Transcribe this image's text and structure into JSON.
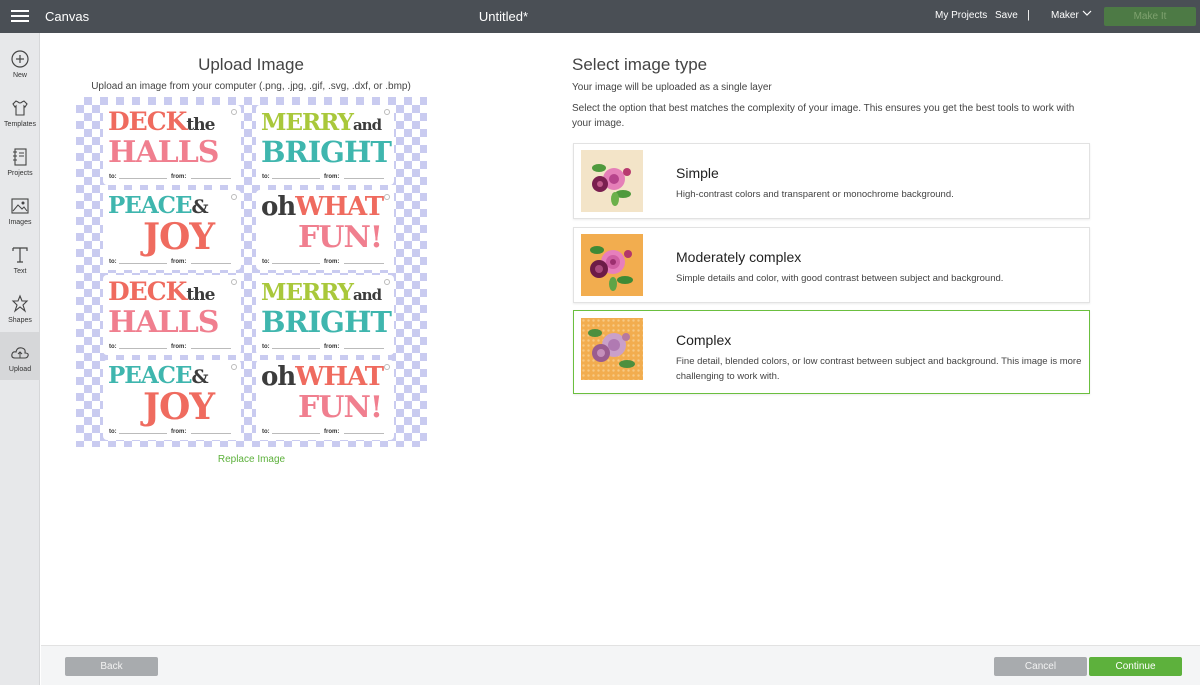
{
  "topbar": {
    "app_title": "Canvas",
    "doc_title": "Untitled*",
    "my_projects": "My Projects",
    "save": "Save",
    "separator": "|",
    "machine": "Maker",
    "make_it": "Make It"
  },
  "sidebar": {
    "items": [
      {
        "label": "New",
        "icon": "plus-circle-icon"
      },
      {
        "label": "Templates",
        "icon": "tshirt-icon"
      },
      {
        "label": "Projects",
        "icon": "notebook-icon"
      },
      {
        "label": "Images",
        "icon": "image-icon"
      },
      {
        "label": "Text",
        "icon": "text-t-icon"
      },
      {
        "label": "Shapes",
        "icon": "shapes-icon"
      },
      {
        "label": "Upload",
        "icon": "cloud-upload-icon"
      }
    ]
  },
  "upload": {
    "title": "Upload Image",
    "subtitle": "Upload an image from your computer (.png, .jpg, .gif, .svg, .dxf, or .bmp)",
    "replace_link": "Replace Image",
    "tags": [
      {
        "w1a": "DECK",
        "w1b": "the",
        "w2": "HALLS",
        "to": "to:",
        "from": "from:"
      },
      {
        "w1a": "MERRY",
        "w1b": "and",
        "w2": "BRIGHT",
        "to": "to:",
        "from": "from:"
      },
      {
        "w1a": "PEACE",
        "w1b": "&",
        "w2": "JOY",
        "to": "to:",
        "from": "from:"
      },
      {
        "w1a": "oh",
        "w1b": "WHAT",
        "w2": "FUN!",
        "to": "to:",
        "from": "from:"
      }
    ]
  },
  "image_type": {
    "title": "Select image type",
    "subtitle": "Your image will be uploaded as a single layer",
    "description": "Select the option that best matches the complexity of your image. This ensures you get the best tools to work with your image.",
    "options": [
      {
        "name": "Simple",
        "desc": "High-contrast colors and transparent or monochrome background.",
        "selected": false
      },
      {
        "name": "Moderately complex",
        "desc": "Simple details and color, with good contrast between subject and background.",
        "selected": false
      },
      {
        "name": "Complex",
        "desc": "Fine detail, blended colors, or low contrast between subject and background. This image is more challenging to work with.",
        "selected": true
      }
    ]
  },
  "footer": {
    "back": "Back",
    "cancel": "Cancel",
    "continue": "Continue"
  },
  "colors": {
    "accent_green": "#5db13c",
    "topbar": "#4a4f55",
    "coral": "#ef6b5f",
    "teal": "#3fb6ae",
    "lime": "#a9c83b",
    "pink": "#f07f8f",
    "dark": "#3c3c3c"
  }
}
